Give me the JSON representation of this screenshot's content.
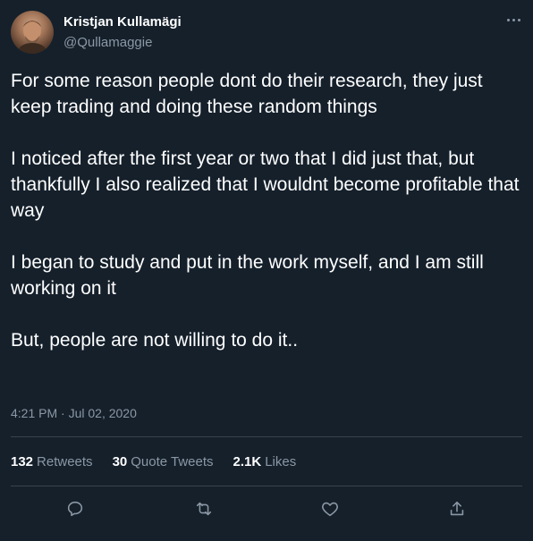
{
  "author": {
    "name": "Kristjan Kullamägi",
    "handle": "@Qullamaggie"
  },
  "tweet": {
    "paragraphs": [
      "For some reason people dont do their research, they just keep trading and doing these random things",
      "I noticed after the first year or two that I did just that, but thankfully I also realized that I wouldnt become profitable that way",
      "I began to study and put in the work myself, and I am still working on it",
      "But, people are not willing to do it.."
    ],
    "timestamp": "4:21 PM · Jul 02, 2020"
  },
  "stats": {
    "retweets_count": "132",
    "retweets_label": "Retweets",
    "quotes_count": "30",
    "quotes_label": "Quote Tweets",
    "likes_count": "2.1K",
    "likes_label": "Likes"
  },
  "icons": {
    "more": "more-horizontal-icon",
    "reply": "reply-icon",
    "retweet": "retweet-icon",
    "like": "heart-icon",
    "share": "share-icon"
  },
  "colors": {
    "background": "#15202b",
    "text_primary": "#ffffff",
    "text_secondary": "#8b98a5",
    "divider": "#38444d"
  }
}
